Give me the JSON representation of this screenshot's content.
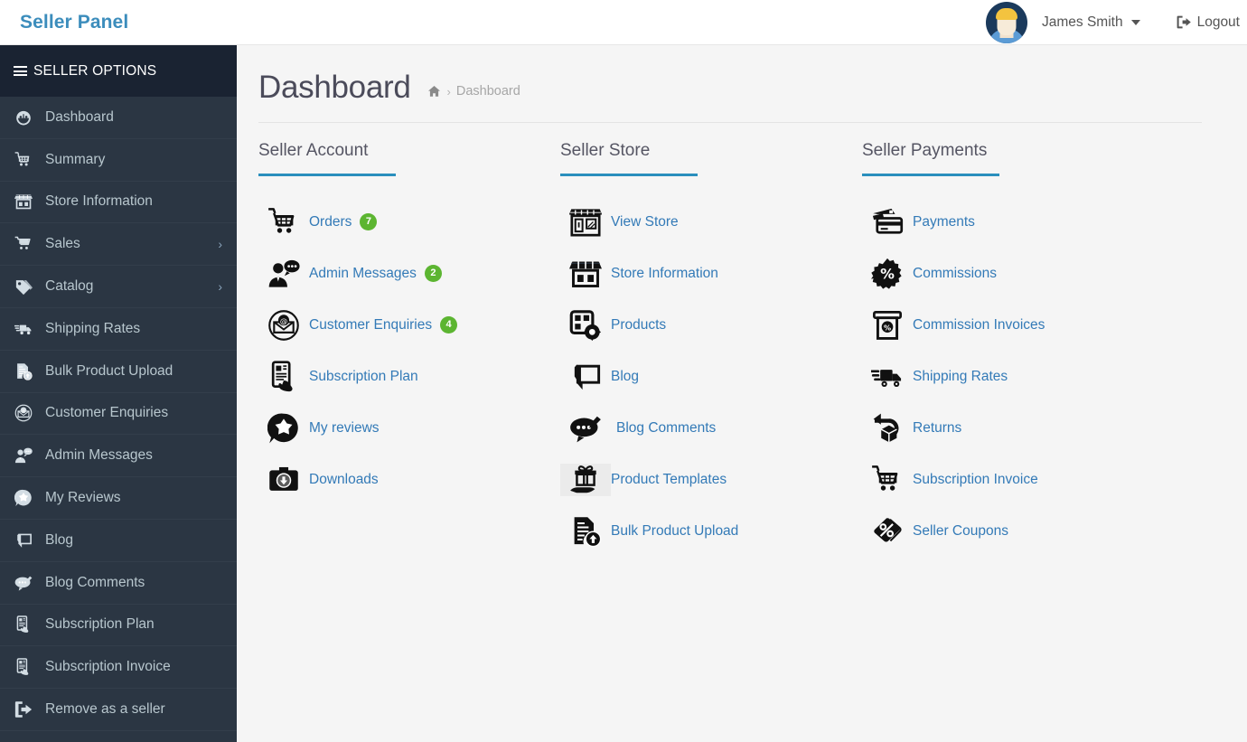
{
  "topbar": {
    "brand": "Seller Panel",
    "user_name": "James Smith",
    "logout_label": "Logout",
    "avatar_icon": "user-avatar",
    "caret_icon": "caret-down-icon",
    "logout_icon": "sign-out-icon",
    "brand_color": "#3c8dbc"
  },
  "sidebar": {
    "header_label": "SELLER OPTIONS",
    "header_icon": "hamburger-icon",
    "items": [
      {
        "label": "Dashboard",
        "icon": "dashboard-gauge-icon",
        "arrow": ""
      },
      {
        "label": "Summary",
        "icon": "shopping-cart-icon",
        "arrow": ""
      },
      {
        "label": "Store Information",
        "icon": "store-front-icon",
        "arrow": ""
      },
      {
        "label": "Sales",
        "icon": "cart-solid-icon",
        "arrow": "›"
      },
      {
        "label": "Catalog",
        "icon": "tag-icon",
        "arrow": "›"
      },
      {
        "label": "Shipping Rates",
        "icon": "delivery-truck-icon",
        "arrow": ""
      },
      {
        "label": "Bulk Product Upload",
        "icon": "file-upload-icon",
        "arrow": ""
      },
      {
        "label": "Customer Enquiries",
        "icon": "envelope-circle-icon",
        "arrow": ""
      },
      {
        "label": "Admin Messages",
        "icon": "user-chat-icon",
        "arrow": ""
      },
      {
        "label": "My Reviews",
        "icon": "star-chat-icon",
        "arrow": ""
      },
      {
        "label": "Blog",
        "icon": "blog-pencil-icon",
        "arrow": ""
      },
      {
        "label": "Blog Comments",
        "icon": "comment-pencil-icon",
        "arrow": ""
      },
      {
        "label": "Subscription Plan",
        "icon": "document-hand-icon",
        "arrow": ""
      },
      {
        "label": "Subscription Invoice",
        "icon": "document-hand-icon",
        "arrow": ""
      },
      {
        "label": "Remove as a seller",
        "icon": "sign-out-icon",
        "arrow": ""
      }
    ]
  },
  "page": {
    "title": "Dashboard",
    "breadcrumb_home_icon": "home-icon",
    "breadcrumb_separator": "›",
    "breadcrumb_current": "Dashboard",
    "accent_color": "#2a8fbd",
    "link_color": "#337ab7",
    "badge_color": "#5cb531"
  },
  "columns": [
    {
      "title": "Seller Account",
      "links": [
        {
          "label": "Orders",
          "icon": "shopping-cart-icon",
          "badge": "7"
        },
        {
          "label": "Admin Messages",
          "icon": "user-chat-icon",
          "badge": "2"
        },
        {
          "label": "Customer Enquiries",
          "icon": "envelope-circle-icon",
          "badge": "4"
        },
        {
          "label": "Subscription Plan",
          "icon": "document-hand-icon",
          "badge": ""
        },
        {
          "label": "My reviews",
          "icon": "star-chat-icon",
          "badge": ""
        },
        {
          "label": "Downloads",
          "icon": "download-box-icon",
          "badge": ""
        }
      ]
    },
    {
      "title": "Seller Store",
      "links": [
        {
          "label": "View Store",
          "icon": "storefront-window-icon",
          "badge": ""
        },
        {
          "label": "Store Information",
          "icon": "store-front-icon",
          "badge": ""
        },
        {
          "label": "Products",
          "icon": "products-gear-icon",
          "badge": ""
        },
        {
          "label": "Blog",
          "icon": "blog-pencil-icon",
          "badge": ""
        },
        {
          "label": "Blog Comments",
          "icon": "comment-pencil-icon",
          "badge": ""
        },
        {
          "label": "Product Templates",
          "icon": "gift-hand-icon",
          "badge": ""
        },
        {
          "label": "Bulk Product Upload",
          "icon": "file-upload-icon",
          "badge": ""
        }
      ]
    },
    {
      "title": "Seller Payments",
      "links": [
        {
          "label": "Payments",
          "icon": "credit-cards-icon",
          "badge": ""
        },
        {
          "label": "Commissions",
          "icon": "percent-badge-icon",
          "badge": ""
        },
        {
          "label": "Commission Invoices",
          "icon": "invoice-percent-icon",
          "badge": ""
        },
        {
          "label": "Shipping Rates",
          "icon": "delivery-truck-icon",
          "badge": ""
        },
        {
          "label": "Returns",
          "icon": "return-box-icon",
          "badge": ""
        },
        {
          "label": "Subscription Invoice",
          "icon": "shopping-cart-icon",
          "badge": ""
        },
        {
          "label": "Seller Coupons",
          "icon": "coupon-percent-icon",
          "badge": ""
        }
      ]
    }
  ]
}
